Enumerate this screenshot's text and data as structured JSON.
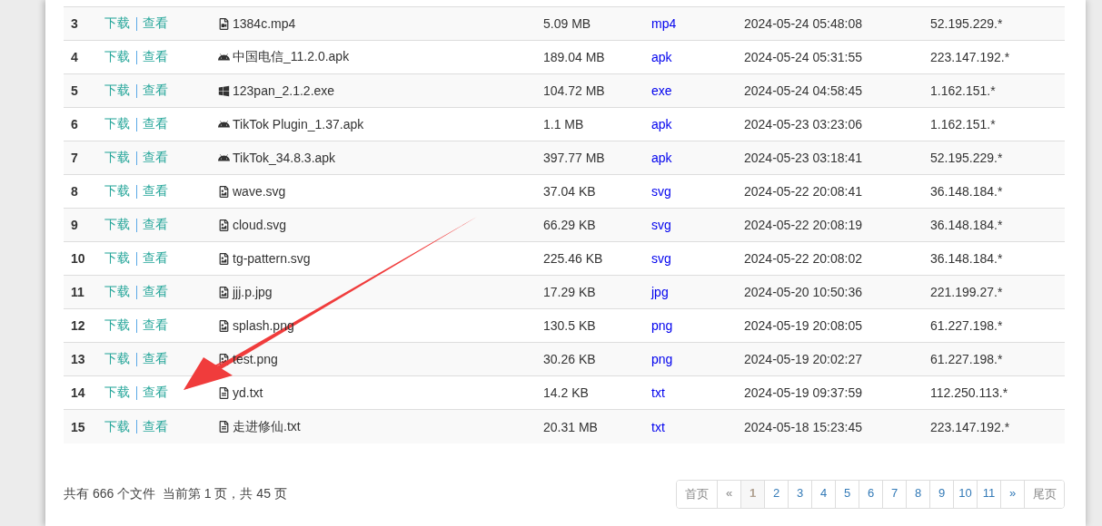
{
  "rows": [
    {
      "index": "3",
      "download": "下载",
      "view": "查看",
      "kind": "video",
      "name": "1384c.mp4",
      "size": "5.09 MB",
      "type": "mp4",
      "time": "2024-05-24 05:48:08",
      "ip": "52.195.229.*"
    },
    {
      "index": "4",
      "download": "下载",
      "view": "查看",
      "kind": "android",
      "name": "中国电信_11.2.0.apk",
      "size": "189.04 MB",
      "type": "apk",
      "time": "2024-05-24 05:31:55",
      "ip": "223.147.192.*"
    },
    {
      "index": "5",
      "download": "下载",
      "view": "查看",
      "kind": "windows",
      "name": "123pan_2.1.2.exe",
      "size": "104.72 MB",
      "type": "exe",
      "time": "2024-05-24 04:58:45",
      "ip": "1.162.151.*"
    },
    {
      "index": "6",
      "download": "下载",
      "view": "查看",
      "kind": "android",
      "name": "TikTok Plugin_1.37.apk",
      "size": "1.1 MB",
      "type": "apk",
      "time": "2024-05-23 03:23:06",
      "ip": "1.162.151.*"
    },
    {
      "index": "7",
      "download": "下载",
      "view": "查看",
      "kind": "android",
      "name": "TikTok_34.8.3.apk",
      "size": "397.77 MB",
      "type": "apk",
      "time": "2024-05-23 03:18:41",
      "ip": "52.195.229.*"
    },
    {
      "index": "8",
      "download": "下载",
      "view": "查看",
      "kind": "image",
      "name": "wave.svg",
      "size": "37.04 KB",
      "type": "svg",
      "time": "2024-05-22 20:08:41",
      "ip": "36.148.184.*"
    },
    {
      "index": "9",
      "download": "下载",
      "view": "查看",
      "kind": "image",
      "name": "cloud.svg",
      "size": "66.29 KB",
      "type": "svg",
      "time": "2024-05-22 20:08:19",
      "ip": "36.148.184.*"
    },
    {
      "index": "10",
      "download": "下载",
      "view": "查看",
      "kind": "image",
      "name": "tg-pattern.svg",
      "size": "225.46 KB",
      "type": "svg",
      "time": "2024-05-22 20:08:02",
      "ip": "36.148.184.*"
    },
    {
      "index": "11",
      "download": "下载",
      "view": "查看",
      "kind": "image",
      "name": "jjj.p.jpg",
      "size": "17.29 KB",
      "type": "jpg",
      "time": "2024-05-20 10:50:36",
      "ip": "221.199.27.*"
    },
    {
      "index": "12",
      "download": "下载",
      "view": "查看",
      "kind": "image",
      "name": "splash.png",
      "size": "130.5 KB",
      "type": "png",
      "time": "2024-05-19 20:08:05",
      "ip": "61.227.198.*"
    },
    {
      "index": "13",
      "download": "下载",
      "view": "查看",
      "kind": "image",
      "name": "test.png",
      "size": "30.26 KB",
      "type": "png",
      "time": "2024-05-19 20:02:27",
      "ip": "61.227.198.*"
    },
    {
      "index": "14",
      "download": "下载",
      "view": "查看",
      "kind": "text",
      "name": "yd.txt",
      "size": "14.2 KB",
      "type": "txt",
      "time": "2024-05-19 09:37:59",
      "ip": "112.250.113.*"
    },
    {
      "index": "15",
      "download": "下载",
      "view": "查看",
      "kind": "text",
      "name": "走进修仙.txt",
      "size": "20.31 MB",
      "type": "txt",
      "time": "2024-05-18 15:23:45",
      "ip": "223.147.192.*"
    }
  ],
  "summary": "共有 666 个文件  当前第 1 页，共 45 页",
  "pagination": [
    {
      "label": "首页",
      "disabled": true,
      "selected": false
    },
    {
      "label": "«",
      "disabled": true,
      "selected": false
    },
    {
      "label": "1",
      "disabled": false,
      "selected": true
    },
    {
      "label": "2",
      "disabled": false,
      "selected": false
    },
    {
      "label": "3",
      "disabled": false,
      "selected": false
    },
    {
      "label": "4",
      "disabled": false,
      "selected": false
    },
    {
      "label": "5",
      "disabled": false,
      "selected": false
    },
    {
      "label": "6",
      "disabled": false,
      "selected": false
    },
    {
      "label": "7",
      "disabled": false,
      "selected": false
    },
    {
      "label": "8",
      "disabled": false,
      "selected": false
    },
    {
      "label": "9",
      "disabled": false,
      "selected": false
    },
    {
      "label": "10",
      "disabled": false,
      "selected": false
    },
    {
      "label": "11",
      "disabled": false,
      "selected": false
    },
    {
      "label": "»",
      "disabled": false,
      "selected": false
    },
    {
      "label": "尾页",
      "disabled": true,
      "selected": false
    }
  ]
}
